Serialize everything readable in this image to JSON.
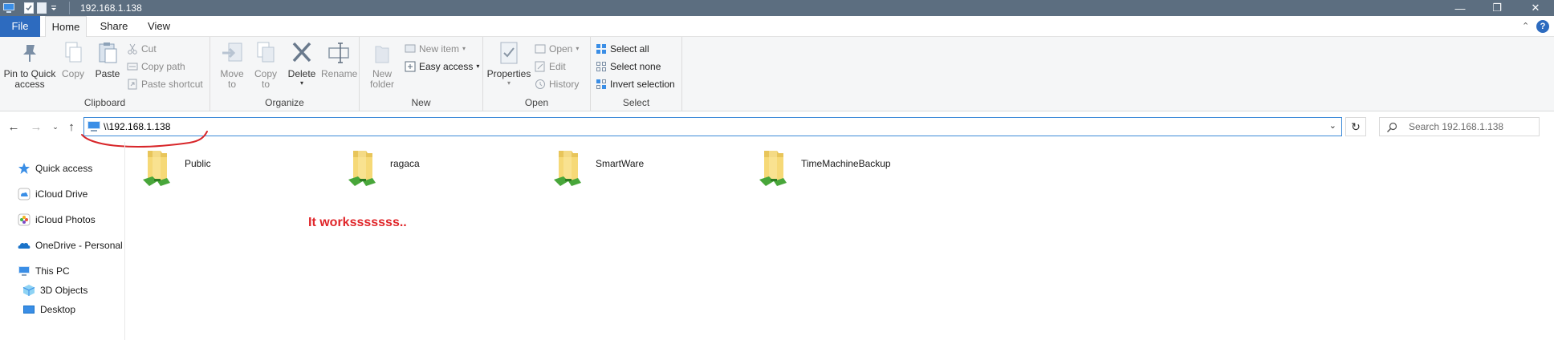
{
  "window": {
    "title": "192.168.1.138",
    "controls": {
      "minimize": "—",
      "maximize": "❐",
      "close": "✕"
    }
  },
  "ribbon_tabs": [
    {
      "label": "File"
    },
    {
      "label": "Home"
    },
    {
      "label": "Share"
    },
    {
      "label": "View"
    }
  ],
  "ribbon": {
    "clipboard": {
      "label": "Clipboard",
      "pin_line1": "Pin to Quick",
      "pin_line2": "access",
      "copy": "Copy",
      "paste": "Paste",
      "cut": "Cut",
      "copy_path": "Copy path",
      "paste_shortcut": "Paste shortcut"
    },
    "organize": {
      "label": "Organize",
      "move_line1": "Move",
      "move_line2": "to",
      "copyto_line1": "Copy",
      "copyto_line2": "to",
      "delete": "Delete",
      "rename": "Rename"
    },
    "new": {
      "label": "New",
      "new_folder_line1": "New",
      "new_folder_line2": "folder",
      "new_item": "New item",
      "easy_access": "Easy access"
    },
    "open": {
      "label": "Open",
      "properties": "Properties",
      "open": "Open",
      "edit": "Edit",
      "history": "History"
    },
    "select": {
      "label": "Select",
      "select_all": "Select all",
      "select_none": "Select none",
      "invert_selection": "Invert selection"
    }
  },
  "address_bar": {
    "path": "\\\\192.168.1.138",
    "search_placeholder": "Search 192.168.1.138"
  },
  "nav_pane": {
    "items": [
      {
        "label": "Quick access"
      },
      {
        "label": "iCloud Drive"
      },
      {
        "label": "iCloud Photos"
      },
      {
        "label": "OneDrive - Personal"
      },
      {
        "label": "This PC"
      },
      {
        "label": "3D Objects"
      },
      {
        "label": "Desktop"
      }
    ]
  },
  "folders": [
    {
      "name": "Public"
    },
    {
      "name": "ragaca"
    },
    {
      "name": "SmartWare"
    },
    {
      "name": "TimeMachineBackup"
    }
  ],
  "annotation": "It worksssssss..",
  "colors": {
    "title_bar": "#5c6e80",
    "file_tab": "#2d6bbf",
    "annotation": "#e0262a",
    "address_border": "#3c8ad8"
  }
}
